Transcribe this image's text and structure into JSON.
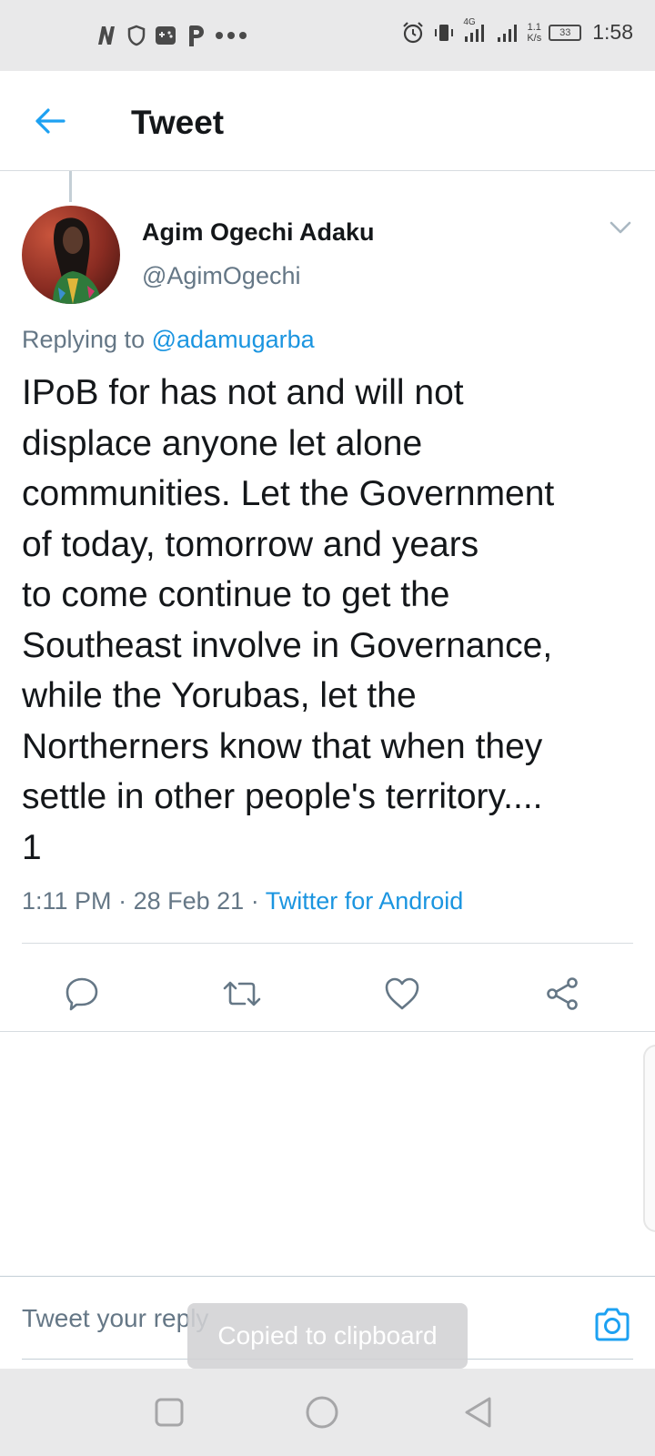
{
  "status_bar": {
    "left_icons": [
      "netflix-n-icon",
      "shield-icon",
      "gamepad-icon",
      "p-app-icon",
      "more-dots-icon"
    ],
    "network": "4G",
    "speed_value": "1.1",
    "speed_unit": "K/s",
    "battery": "33",
    "time": "1:58"
  },
  "header": {
    "title": "Tweet"
  },
  "tweet": {
    "author_name": "Agim Ogechi Adaku",
    "author_handle": "@AgimOgechi",
    "replying_prefix": "Replying to",
    "replying_to": "@adamugarba",
    "text_lines": [
      "IPoB for has not and will not",
      "displace anyone let alone",
      "communities. Let the Government",
      "of today, tomorrow and years",
      "to come continue to get the",
      "Southeast involve in Governance,",
      "while the Yorubas, let the",
      "Northerners know that when they",
      "settle in other people's territory....",
      "1"
    ],
    "time": "1:11 PM",
    "date": "28 Feb 21",
    "separator": "·",
    "source": "Twitter for Android"
  },
  "actions": [
    "reply-icon",
    "retweet-icon",
    "like-icon",
    "share-icon"
  ],
  "reply_bar": {
    "placeholder": "Tweet your reply"
  },
  "toast": {
    "text": "Copied to clipboard"
  },
  "colors": {
    "accent": "#1da1f2",
    "link": "#1b95e0",
    "secondary_text": "#657786",
    "primary_text": "#14171a",
    "system_bar": "#e9e9ea"
  }
}
